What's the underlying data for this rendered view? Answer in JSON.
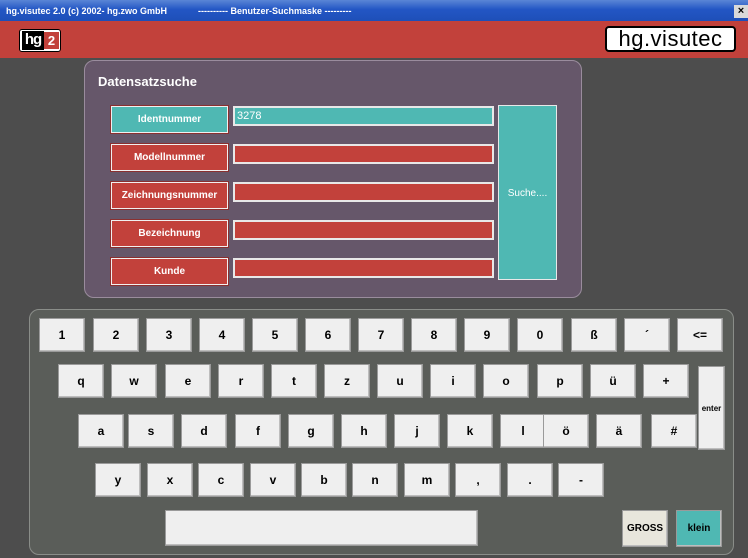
{
  "window": {
    "title": "hg.visutec 2.0  (c) 2002- hg.zwo GmbH",
    "subtitle": "----------  Benutzer-Suchmaske  ---------",
    "close_label": "×"
  },
  "header": {
    "logo_left_hg": "hg",
    "logo_left_two": "2",
    "logo_right": "hg.visutec",
    "bar_color": "#c2413b"
  },
  "search": {
    "title": "Datensatzsuche",
    "fields": [
      {
        "label": "Identnummer",
        "value": "3278",
        "active": true
      },
      {
        "label": "Modellnummer",
        "value": "",
        "active": false
      },
      {
        "label": "Zeichnungsnummer",
        "value": "",
        "active": false
      },
      {
        "label": "Bezeichnung",
        "value": "",
        "active": false
      },
      {
        "label": "Kunde",
        "value": "",
        "active": false
      }
    ],
    "search_button": "Suche....",
    "accent_red": "#c2413b",
    "accent_teal": "#4fb8b3"
  },
  "keyboard": {
    "row1": [
      "1",
      "2",
      "3",
      "4",
      "5",
      "6",
      "7",
      "8",
      "9",
      "0",
      "ß",
      "´",
      "<="
    ],
    "row2": [
      "q",
      "w",
      "e",
      "r",
      "t",
      "z",
      "u",
      "i",
      "o",
      "p",
      "ü",
      "+"
    ],
    "row3": [
      "a",
      "s",
      "d",
      "f",
      "g",
      "h",
      "j",
      "k",
      "l",
      "ö",
      "ä",
      "#"
    ],
    "row4": [
      "y",
      "x",
      "c",
      "v",
      "b",
      "n",
      "m",
      ",",
      ".",
      "-"
    ],
    "enter": "enter",
    "space": "",
    "gross": "GROSS",
    "klein": "klein"
  }
}
